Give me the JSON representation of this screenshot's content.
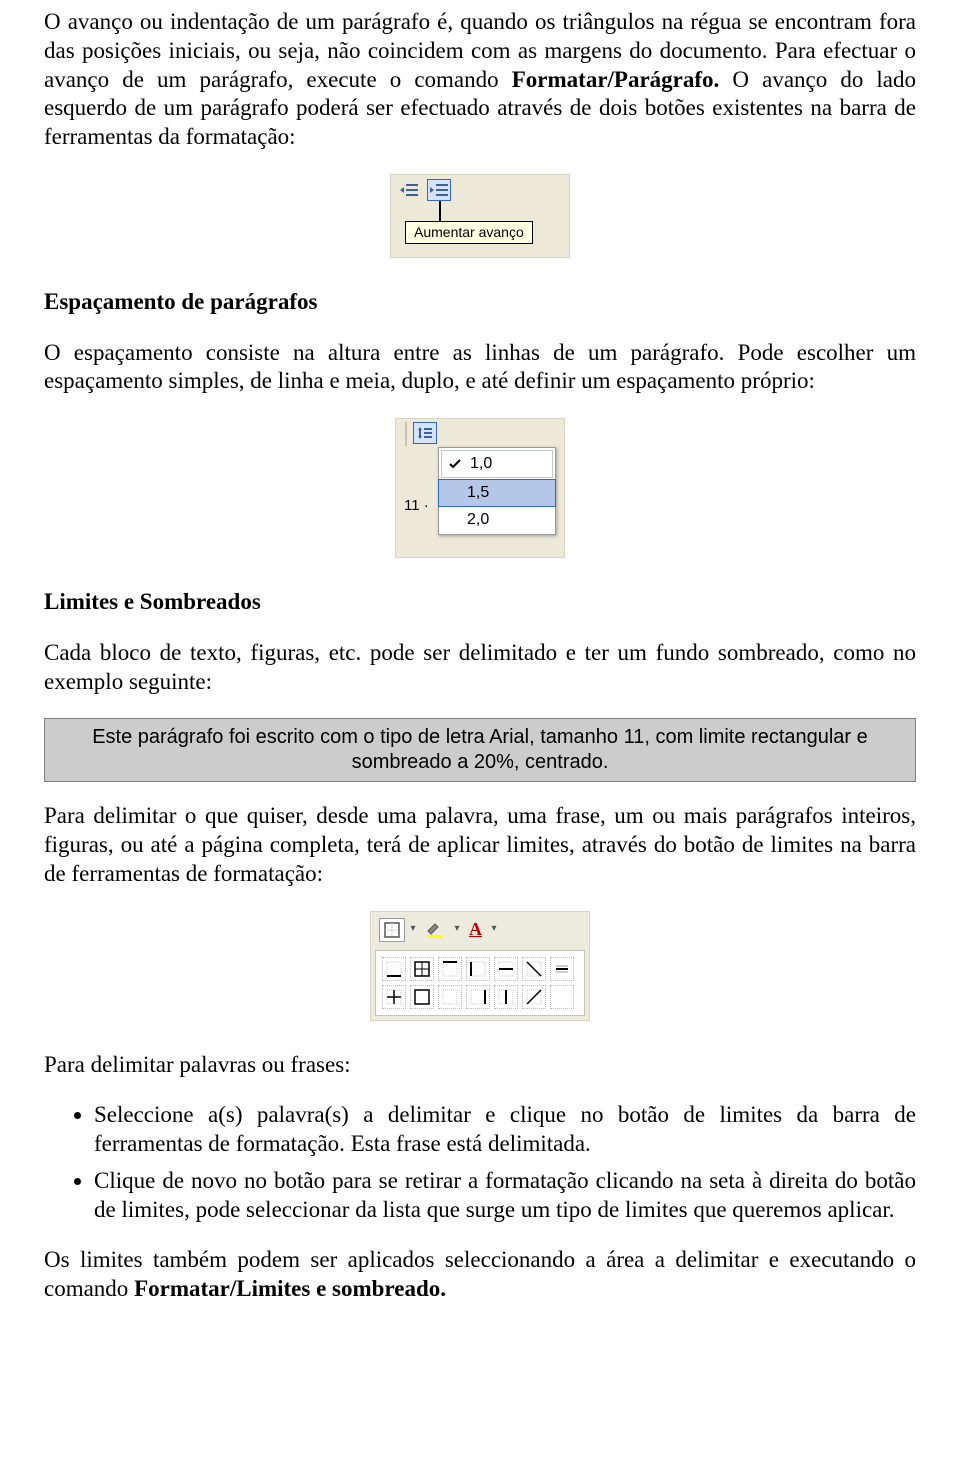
{
  "para1_run1": "O avanço ou indentação de um parágrafo é, quando os triângulos na régua se encontram fora das posições iniciais, ou seja, não coincidem com as margens do documento. Para efectuar o avanço de um parágrafo, execute o comando ",
  "para1_bold": "Formatar/Parágrafo.",
  "para1_run2": " O avanço do lado esquerdo de um parágrafo poderá ser efectuado através de dois botões existentes na barra de ferramentas da formatação:",
  "fig1": {
    "tooltip": "Aumentar avanço",
    "btn1_name": "decrease-indent-icon",
    "btn2_name": "increase-indent-icon"
  },
  "heading1": "Espaçamento de parágrafos",
  "para2": "O espaçamento consiste na altura entre as linhas de um parágrafo. Pode escolher um espaçamento simples, de linha e meia, duplo, e até definir um espaçamento próprio:",
  "fig2": {
    "sidebar_text": "11 ·",
    "options": [
      "1,0",
      "1,5",
      "2,0"
    ],
    "checked_index": 0,
    "highlighted_index": 1
  },
  "heading2": "Limites e Sombreados",
  "para3": "Cada bloco de texto, figuras, etc. pode ser delimitado e ter um fundo sombreado, como no exemplo seguinte:",
  "example_box": "Este parágrafo foi escrito com o tipo de letra Arial, tamanho 11, com limite rectangular e sombreado a 20%, centrado.",
  "para4": "Para delimitar o que quiser, desde uma palavra, uma frase, um ou mais parágrafos inteiros, figuras, ou até a página completa, terá de  aplicar limites, através do botão de limites na barra de ferramentas de formatação:",
  "fig3": {
    "font_color_label": "A"
  },
  "para5": "Para delimitar palavras ou frases:",
  "bullets": [
    {
      "run1": "Seleccione a(s) palavra(s) a delimitar e clique no botão de limites da barra de ferramentas de formatação. ",
      "underlined": "Esta frase está delimitada.",
      "run2": ""
    },
    {
      "run1": "Clique de novo no botão para se retirar a formatação clicando na seta à direita do botão de limites, pode seleccionar da lista que surge um tipo de limites que queremos aplicar.",
      "underlined": "",
      "run2": ""
    }
  ],
  "para6_run1": "Os limites também podem ser aplicados seleccionando a área a delimitar e executando o comando ",
  "para6_bold": "Formatar/Limites e sombreado."
}
